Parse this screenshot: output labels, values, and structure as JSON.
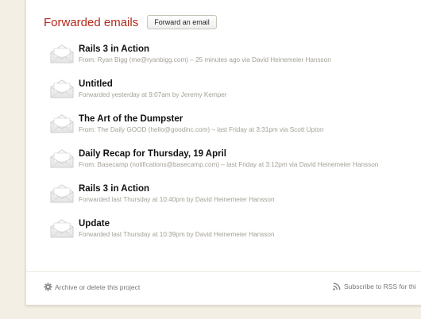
{
  "header": {
    "title": "Forwarded emails",
    "forward_button": "Forward an email"
  },
  "emails": [
    {
      "subject": "Rails 3 in Action",
      "meta": "From: Ryan Bigg (me@ryanbigg.com) – 25 minutes ago via David Heinemeier Hansson"
    },
    {
      "subject": "Untitled",
      "meta": "Forwarded yesterday at 9:07am by Jeremy Kemper"
    },
    {
      "subject": "The Art of the Dumpster",
      "meta": "From: The Daily GOOD (hello@goodinc.com) – last Friday at 3:31pm via Scott Upton"
    },
    {
      "subject": "Daily Recap for Thursday, 19 April",
      "meta": "From: Basecamp (notifications@basecamp.com) – last Friday at 3:12pm via David Heinemeier Hansson"
    },
    {
      "subject": "Rails 3 in Action",
      "meta": "Forwarded last Thursday at 10:40pm by David Heinemeier Hansson"
    },
    {
      "subject": "Update",
      "meta": "Forwarded last Thursday at 10:39pm by David Heinemeier Hansson"
    }
  ],
  "footer": {
    "archive_label": "Archive or delete this project",
    "rss_label": "Subscribe to RSS for thi"
  },
  "icons": {
    "email": "open-envelope-icon",
    "archive": "gear-icon",
    "rss": "rss-icon"
  }
}
